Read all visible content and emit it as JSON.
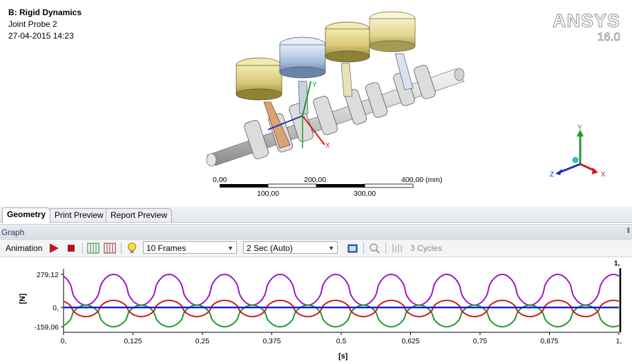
{
  "viewport": {
    "title": "B: Rigid Dynamics",
    "subtitle": "Joint Probe 2",
    "date": "27-04-2015 14:23",
    "brand_name": "ANSYS",
    "brand_version": "16.0",
    "scale": {
      "top_labels": [
        "0,00",
        "200,00",
        "400,00 (mm)"
      ],
      "bottom_labels": [
        "100,00",
        "300,00"
      ]
    },
    "axis_labels": [
      "X",
      "Y",
      "Z"
    ],
    "colors": {
      "x_axis": "#d11a1a",
      "y_axis": "#1a9a2a",
      "z_axis": "#1a2fb8"
    }
  },
  "tabs": [
    {
      "label": "Geometry",
      "active": true
    },
    {
      "label": "Print Preview",
      "active": false
    },
    {
      "label": "Report Preview",
      "active": false
    }
  ],
  "graph": {
    "title": "Graph",
    "pin_icon": "pin-icon"
  },
  "toolbar": {
    "animation_label": "Animation",
    "frames_value": "10 Frames",
    "duration_value": "2 Sec (Auto)",
    "cycles_label": "3 Cycles",
    "icons": [
      "play-icon",
      "stop-icon",
      "distributed-frames-icon",
      "result-frames-icon",
      "lightbulb-icon",
      "export-video-icon",
      "zoom-fit-icon",
      "cycles-icon"
    ]
  },
  "chart_data": {
    "type": "line",
    "ylabel": "[N]",
    "xlabel": "[s]",
    "y_ticks": [
      "279,12",
      "0,",
      "-159,06"
    ],
    "x_ticks": [
      "0,",
      "0,125",
      "0,25",
      "0,375",
      "0,5",
      "0,625",
      "0,75",
      "0,875",
      "1,"
    ],
    "time_marker_label": "1,",
    "xlim": [
      0,
      1
    ],
    "ylim": [
      -159.06,
      279.12
    ],
    "cycles": 10,
    "series": [
      {
        "color": "#9a18c8",
        "peak": 279.12,
        "trough": 20,
        "phase": 0.35
      },
      {
        "color": "#1e9a2a",
        "peak": 20,
        "trough": -159.06,
        "phase": 0.85
      },
      {
        "color": "#d0191e",
        "peak": 60,
        "trough": -75,
        "phase": 0.35
      },
      {
        "color": "#1822c8",
        "peak": 0,
        "trough": 0,
        "phase": 0
      }
    ]
  }
}
